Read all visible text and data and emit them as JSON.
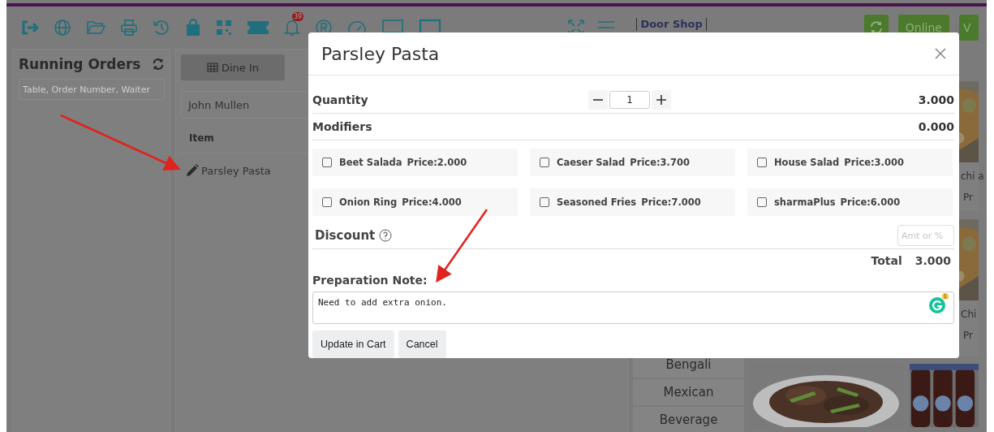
{
  "toolbar": {
    "notification_badge": "39",
    "store_name": "Door Shop",
    "buttons": [
      "Online",
      "V"
    ]
  },
  "running_orders": {
    "title": "Running Orders",
    "search": {
      "placeholder": "Table, Order Number, Waiter"
    }
  },
  "cart": {
    "tabs": [
      {
        "label": "Dine In",
        "selected": true
      }
    ],
    "customer": "John Mullen",
    "columns": [
      "Item"
    ],
    "rows": [
      "Parsley Pasta"
    ]
  },
  "menu": {
    "categories": [
      "Bengali",
      "Mexican",
      "Beverage"
    ],
    "products": [
      {
        "name": "chi a",
        "price": "Pr"
      },
      {
        "name": "Chi",
        "price": "Pr"
      }
    ]
  },
  "modal": {
    "title": "Parsley Pasta",
    "quantity": {
      "label": "Quantity",
      "value": "1",
      "amount": "3.000"
    },
    "modifiers": {
      "label": "Modifiers",
      "amount": "0.000",
      "options": [
        {
          "name": "Beet Salada",
          "price": "Price:2.000",
          "checked": false
        },
        {
          "name": "Caeser Salad",
          "price": "Price:3.700",
          "checked": false
        },
        {
          "name": "House Salad",
          "price": "Price:3.000",
          "checked": false
        },
        {
          "name": "Onion Ring",
          "price": "Price:4.000",
          "checked": false
        },
        {
          "name": "Seasoned Fries",
          "price": "Price:7.000",
          "checked": false
        },
        {
          "name": "sharmaPlus",
          "price": "Price:6.000",
          "checked": false
        }
      ]
    },
    "discount": {
      "label": "Discount",
      "placeholder": "Amt or %"
    },
    "total": {
      "label": "Total",
      "value": "3.000"
    },
    "note": {
      "label": "Preparation Note:",
      "value": "Need to add extra onion.",
      "grammar_badge": "1"
    },
    "buttons": [
      "Update in Cart",
      "Cancel"
    ]
  }
}
